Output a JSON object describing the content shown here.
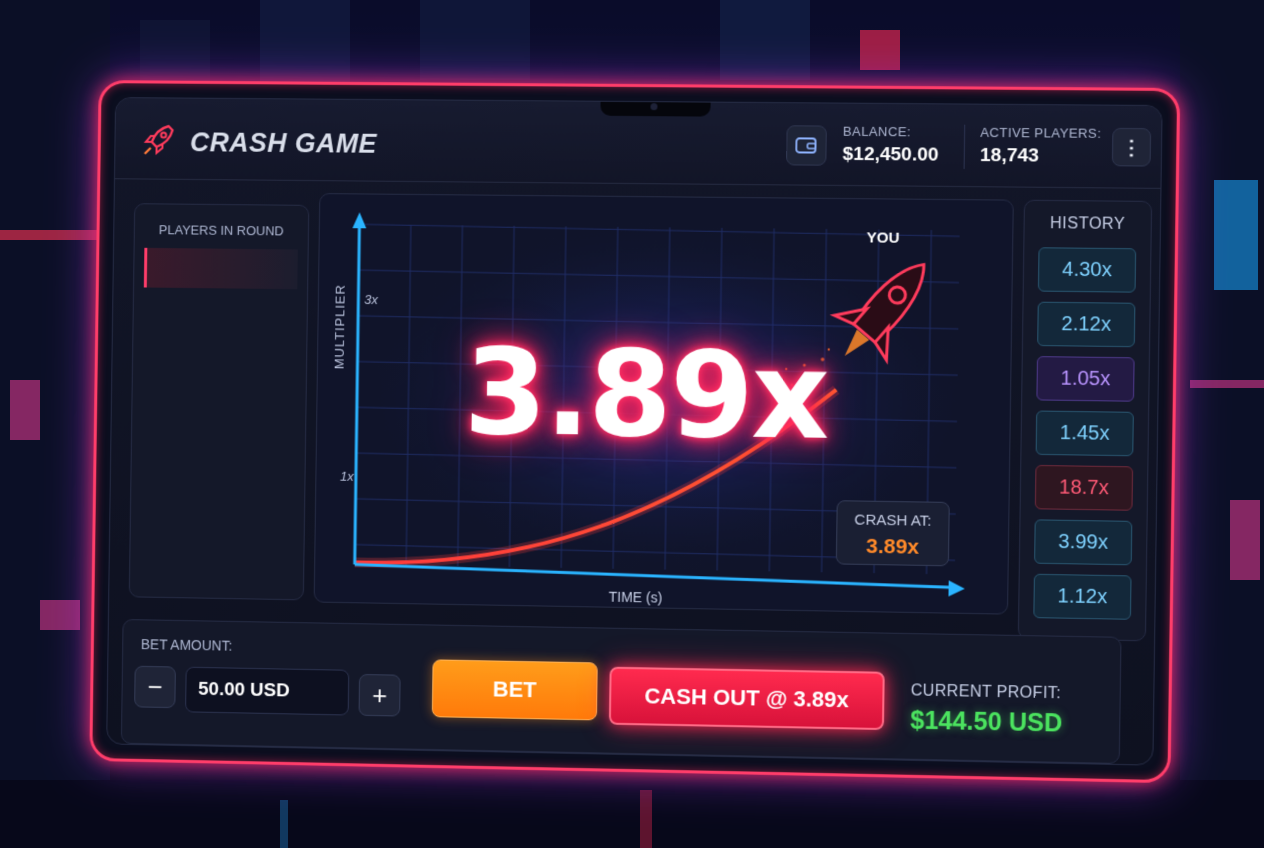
{
  "header": {
    "title": "CRASH GAME",
    "balance_label": "BALANCE:",
    "balance_value": "$12,450.00",
    "active_players_label": "ACTIVE PLAYERS:",
    "active_players_value": "18,743",
    "logo_icon": "rocket-icon",
    "wallet_icon": "wallet-icon",
    "menu_icon": "kebab-menu-icon"
  },
  "players_panel": {
    "title": "PLAYERS IN ROUND"
  },
  "graph": {
    "multiplier": "3.89x",
    "you_label": "YOU",
    "y_axis_label": "MULTIPLIER",
    "x_axis_label": "TIME (s)",
    "y_ticks": [
      "3x",
      "1x"
    ],
    "crash_label": "CRASH AT:",
    "crash_value": "3.89x"
  },
  "history": {
    "title": "HISTORY",
    "items": [
      {
        "value": "4.30x",
        "tone": "blue"
      },
      {
        "value": "2.12x",
        "tone": "blue"
      },
      {
        "value": "1.05x",
        "tone": "purple"
      },
      {
        "value": "1.45x",
        "tone": "blue"
      },
      {
        "value": "18.7x",
        "tone": "red"
      },
      {
        "value": "3.99x",
        "tone": "blue"
      },
      {
        "value": "1.12x",
        "tone": "blue"
      }
    ]
  },
  "bet": {
    "label": "BET AMOUNT:",
    "amount": "50.00 USD",
    "minus": "−",
    "plus": "+",
    "bet_button": "BET",
    "cashout_button": "CASH OUT @ 3.89x",
    "profit_label": "CURRENT PROFIT:",
    "profit_value": "$144.50 USD"
  },
  "colors": {
    "accent_red": "#ff2e63",
    "accent_orange": "#ff8a1a",
    "accent_green": "#4be35f",
    "accent_blue": "#2aa8ff"
  }
}
